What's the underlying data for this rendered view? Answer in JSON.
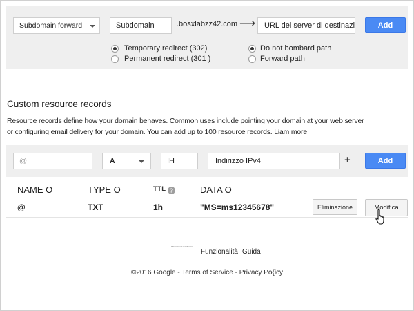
{
  "forwarding": {
    "type_select": "Subdomain forward",
    "subdomain_value": "Subdomain",
    "domain_suffix": ".bosxlabzz42.com",
    "arrow": "⟶",
    "destination_placeholder": "URL del server di destinazione",
    "add_label": "Add",
    "redirect_options": [
      {
        "label": "Temporary redirect (302)",
        "selected": true
      },
      {
        "label": "Permanent redirect (301 )",
        "selected": false
      }
    ],
    "path_options": [
      {
        "label": "Do not bombard path",
        "selected": true
      },
      {
        "label": "Forward path",
        "selected": false
      }
    ]
  },
  "records": {
    "title": "Custom resource records",
    "description_line1": "Resource records define how your domain behaves. Common uses include pointing your domain at your web server",
    "description_line2": "or configuring email delivery for your domain. You can add up to 100 resource records. Liam more",
    "form": {
      "name_placeholder": "@",
      "type_value": "A",
      "ttl_value": "IH",
      "data_value": "Indirizzo IPv4",
      "plus": "+",
      "add_label": "Add"
    },
    "columns": {
      "name": "NAME O",
      "type": "TYPE O",
      "ttl": "TTL",
      "data": "DATA O"
    },
    "rows": [
      {
        "name": "@",
        "type": "TXT",
        "ttl": "1h",
        "data": "\"MS=ms12345678\"",
        "delete_label": "Eliminazione",
        "edit_label": "Modifica"
      }
    ]
  },
  "footer": {
    "tiny_text": "Informazioni sui domini",
    "features_link": "Funzionalità",
    "guide_link": "Guida",
    "copyright": "©2016",
    "google_link": "Google",
    "sep1": " - ",
    "terms_link": "Terms of Service",
    "sep2": " - ",
    "privacy_link": "Privacy Po{icy"
  },
  "icons": {
    "ttl_help": "help-circle-icon",
    "cursor": "hand-pointer-icon",
    "dropdown": "chevron-down-icon"
  }
}
